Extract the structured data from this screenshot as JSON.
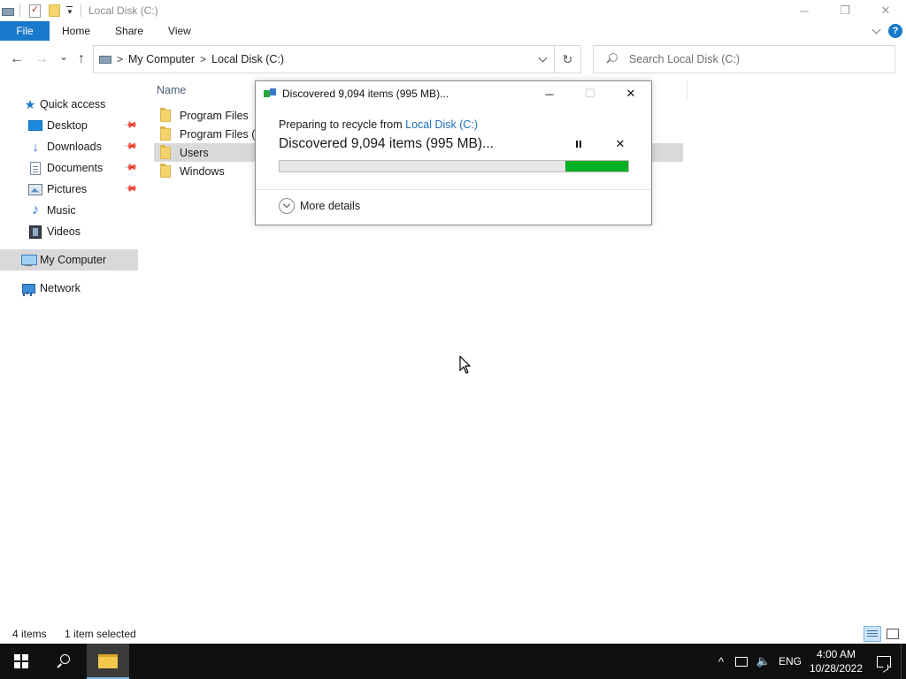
{
  "window": {
    "title": "Local Disk (C:)",
    "controls": {
      "minimize": "─",
      "restore": "❐",
      "close": "✕"
    }
  },
  "ribbon": {
    "file": "File",
    "tabs": [
      "Home",
      "Share",
      "View"
    ],
    "accent": "#1979ca"
  },
  "address": {
    "back": "←",
    "forward": "→",
    "recent": "⌄",
    "up": "↑",
    "crumbs": [
      "My Computer",
      "Local Disk (C:)"
    ],
    "separator": ">",
    "refresh": "↻",
    "search_placeholder": "Search Local Disk (C:)"
  },
  "nav": {
    "quick_access": "Quick access",
    "items": [
      {
        "label": "Desktop",
        "icon": "desktop-icon",
        "pinned": true
      },
      {
        "label": "Downloads",
        "icon": "downloads-icon",
        "pinned": true
      },
      {
        "label": "Documents",
        "icon": "documents-icon",
        "pinned": true
      },
      {
        "label": "Pictures",
        "icon": "pictures-icon",
        "pinned": true
      },
      {
        "label": "Music",
        "icon": "music-icon",
        "pinned": false
      },
      {
        "label": "Videos",
        "icon": "videos-icon",
        "pinned": false
      }
    ],
    "this_pc": "My Computer",
    "network": "Network",
    "pin_glyph": "📌"
  },
  "files": {
    "column_name": "Name",
    "items": [
      {
        "name": "Program Files",
        "selected": false
      },
      {
        "name": "Program Files (x86)",
        "selected": false
      },
      {
        "name": "Users",
        "selected": true
      },
      {
        "name": "Windows",
        "selected": false
      }
    ]
  },
  "status": {
    "item_count": "4 items",
    "selected": "1 item selected"
  },
  "dialog": {
    "title": "Discovered 9,094 items (995 MB)...",
    "preparing_prefix": "Preparing to recycle from",
    "preparing_location": "Local Disk (C:)",
    "discovered": "Discovered 9,094 items (995 MB)...",
    "progress_fraction": 0.18,
    "progress_color": "#06b025",
    "more_details": "More details",
    "minimize": "─",
    "maximize": "☐",
    "close": "✕",
    "cancel": "✕"
  },
  "taskbar": {
    "tray_chevron": "^",
    "volume": "🔈",
    "language": "ENG",
    "time": "4:00 AM",
    "date": "10/28/2022"
  }
}
